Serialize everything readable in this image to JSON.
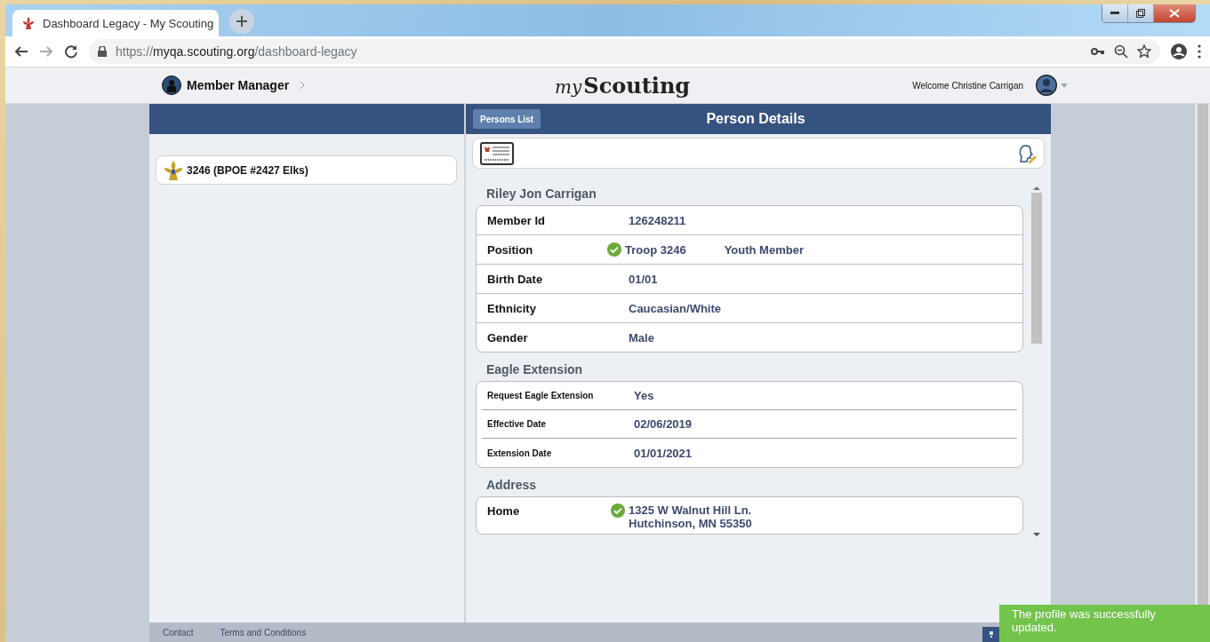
{
  "browser": {
    "tab_title": "Dashboard Legacy - My Scouting",
    "url_scheme": "https://",
    "url_host": "myqa.scouting.org",
    "url_path": "/dashboard-legacy"
  },
  "header": {
    "app_name": "Member Manager",
    "logo_prefix": "my",
    "logo_name": "Scouting",
    "welcome": "Welcome Christine Carrigan"
  },
  "units": [
    {
      "label": "3246 (BPOE #2427 Elks)"
    }
  ],
  "details": {
    "persons_list_button": "Persons List",
    "title": "Person Details",
    "sections": [
      {
        "heading": "Riley Jon Carrigan",
        "kind": "regular",
        "fields": [
          {
            "kind": "text",
            "label": "Member Id",
            "value": "126248211"
          },
          {
            "kind": "position",
            "label": "Position",
            "verified": true,
            "unit": "Troop 3246",
            "role": "Youth Member"
          },
          {
            "kind": "text",
            "label": "Birth Date",
            "value": "01/01"
          },
          {
            "kind": "text",
            "label": "Ethnicity",
            "value": "Caucasian/White"
          },
          {
            "kind": "text",
            "label": "Gender",
            "value": "Male"
          }
        ]
      },
      {
        "heading": "Eagle Extension",
        "kind": "compact",
        "fields": [
          {
            "kind": "text",
            "label": "Request Eagle Extension",
            "value": "Yes"
          },
          {
            "kind": "text",
            "label": "Effective Date",
            "value": "02/06/2019"
          },
          {
            "kind": "text",
            "label": "Extension Date",
            "value": "01/01/2021"
          }
        ]
      },
      {
        "heading": "Address",
        "kind": "regular",
        "fields": [
          {
            "kind": "address",
            "label": "Home",
            "verified": true,
            "lines": [
              "1325 W Walnut Hill Ln.",
              "Hutchinson, MN 55350"
            ]
          }
        ]
      }
    ]
  },
  "footer": {
    "links": [
      "Contact",
      "Terms and Conditions"
    ]
  },
  "toast": {
    "message": "The profile was successfully updated."
  }
}
